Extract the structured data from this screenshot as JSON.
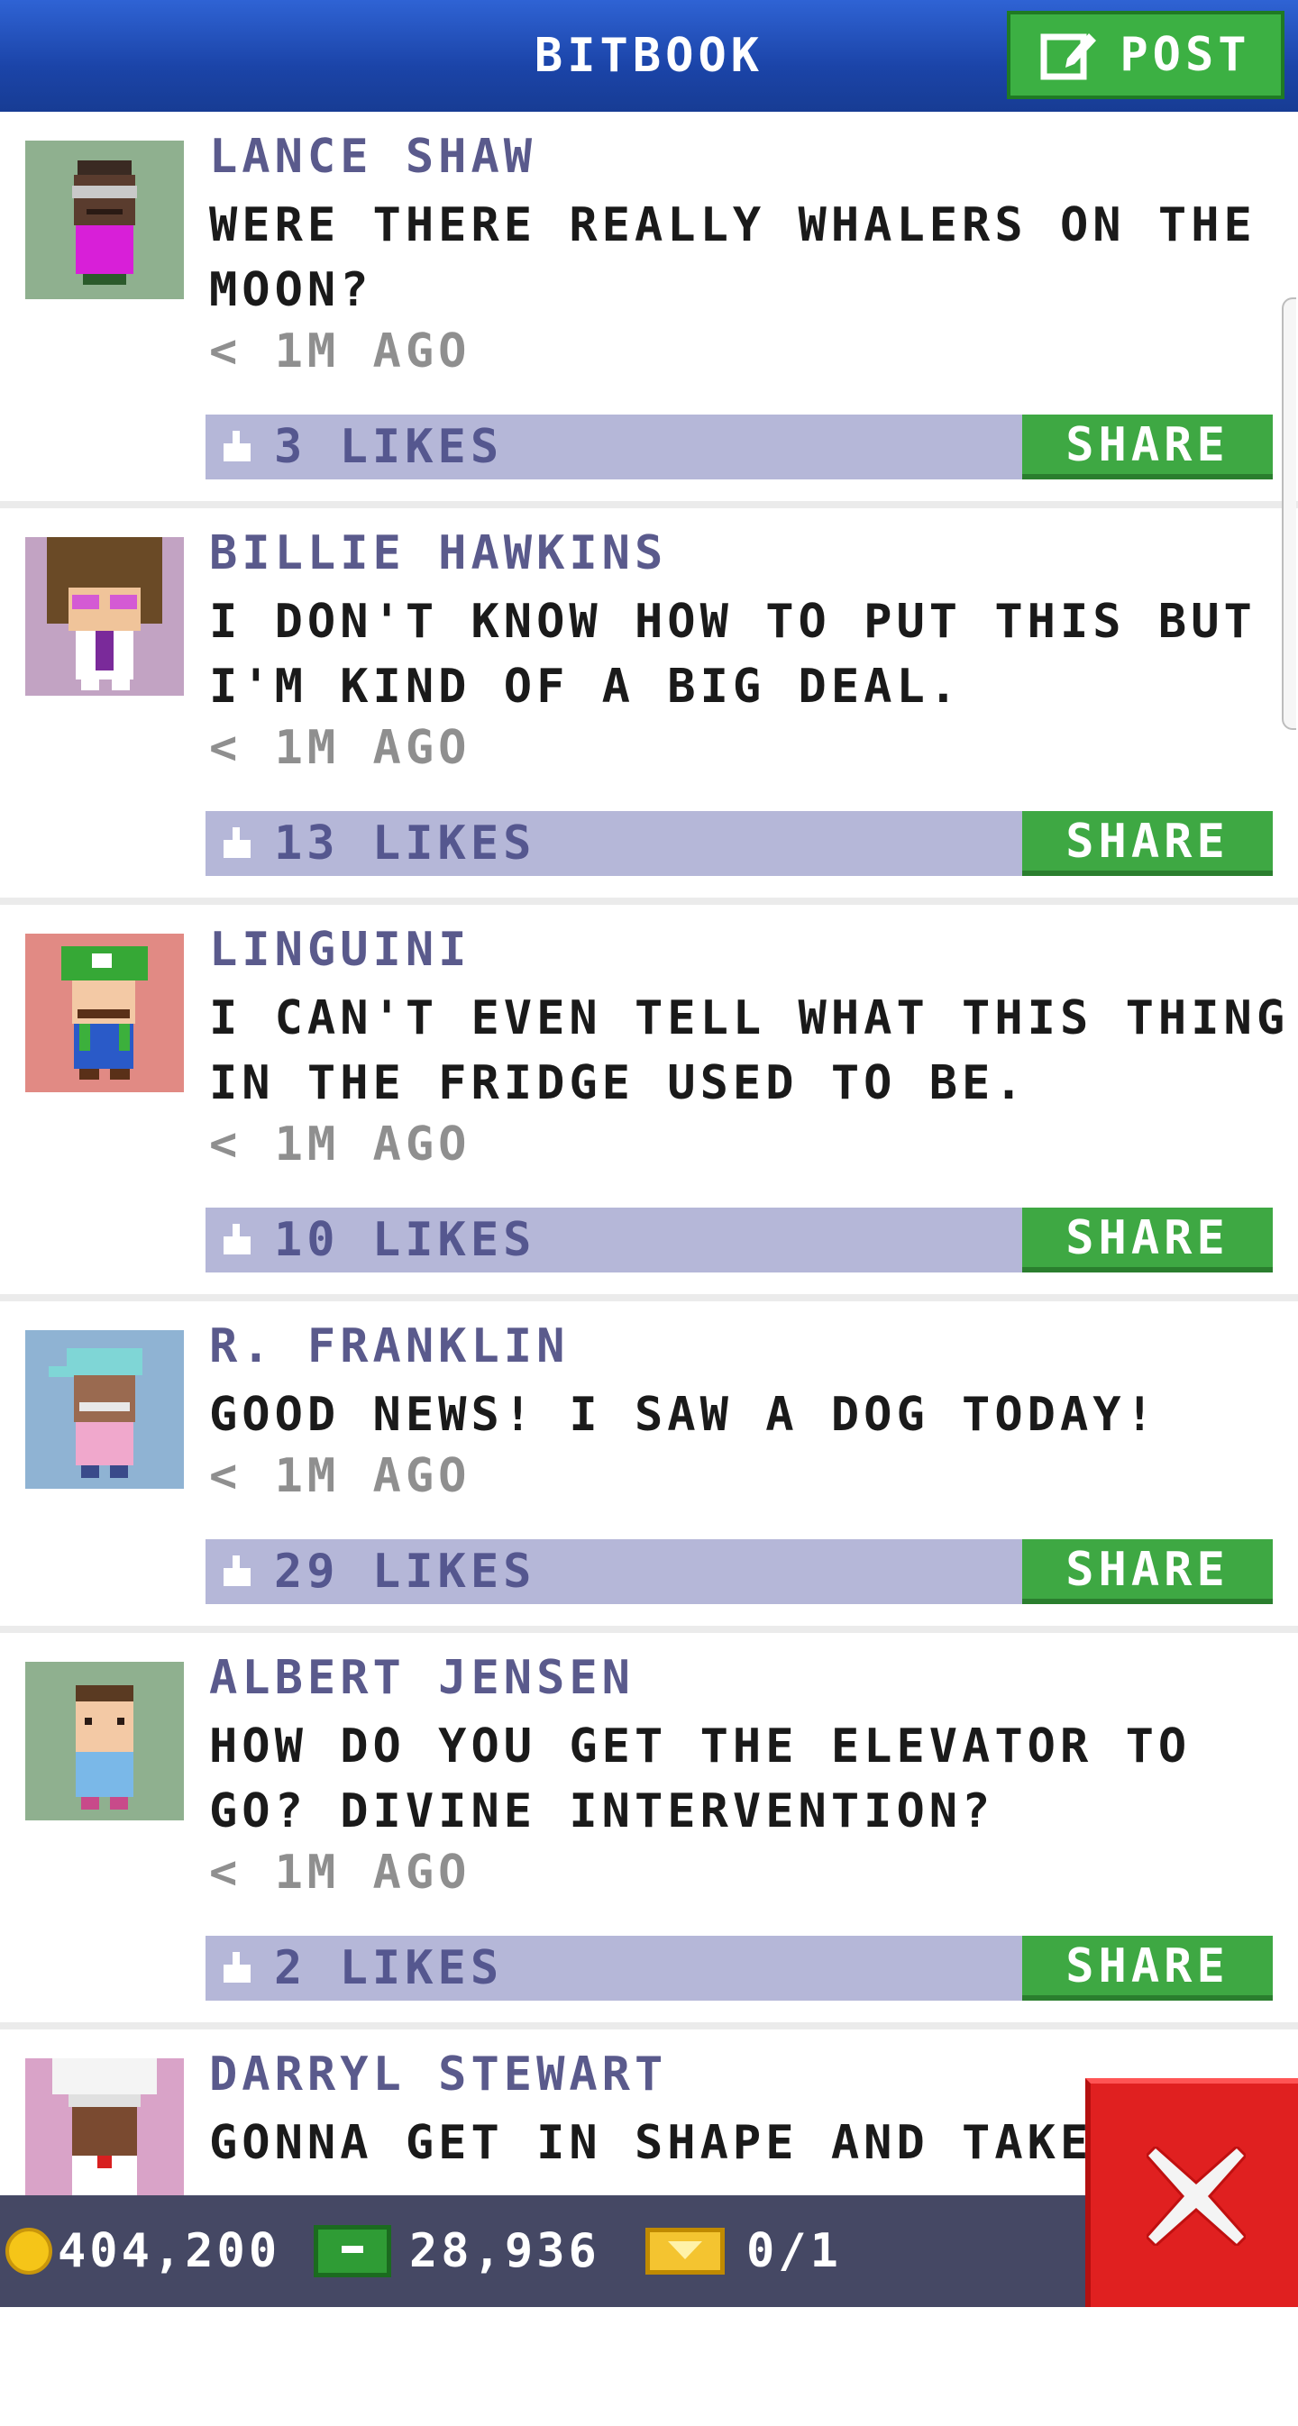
{
  "header": {
    "title": "BITBOOK",
    "post_label": "POST"
  },
  "posts": [
    {
      "author": "LANCE SHAW",
      "message": "WERE THERE REALLY WHALERS ON THE MOON?",
      "time": "< 1M AGO",
      "likes": "3 LIKES",
      "share_label": "SHARE",
      "avatar_bg": "#8fb08f"
    },
    {
      "author": "BILLIE HAWKINS",
      "message": "I DON'T KNOW HOW TO PUT THIS BUT I'M KIND OF A BIG DEAL.",
      "time": "< 1M AGO",
      "likes": "13 LIKES",
      "share_label": "SHARE",
      "avatar_bg": "#c2a3c3"
    },
    {
      "author": "LINGUINI",
      "message": "I CAN'T EVEN TELL WHAT THIS THING IN THE FRIDGE USED TO BE.",
      "time": "< 1M AGO",
      "likes": "10 LIKES",
      "share_label": "SHARE",
      "avatar_bg": "#e18a84"
    },
    {
      "author": "R. FRANKLIN",
      "message": "GOOD NEWS! I SAW A DOG TODAY!",
      "time": "< 1M AGO",
      "likes": "29 LIKES",
      "share_label": "SHARE",
      "avatar_bg": "#8fb3d3"
    },
    {
      "author": "ALBERT JENSEN",
      "message": "HOW DO YOU GET THE ELEVATOR TO GO? DIVINE INTERVENTION?",
      "time": "< 1M AGO",
      "likes": "2 LIKES",
      "share_label": "SHARE",
      "avatar_bg": "#8fb08f"
    },
    {
      "author": "DARRYL STEWART",
      "message": "GONNA GET IN SHAPE AND TAKE",
      "time": "",
      "likes": "",
      "share_label": "",
      "avatar_bg": "#d9a3c8"
    }
  ],
  "bottom_bar": {
    "coins": "404,200",
    "bux": "28,936",
    "tickets": "0/1"
  },
  "icons": {
    "post": "compose-icon",
    "like": "thumbs-up-icon",
    "coin": "coin-icon",
    "bux": "bux-icon",
    "ticket": "ticket-icon",
    "close": "close-icon"
  }
}
